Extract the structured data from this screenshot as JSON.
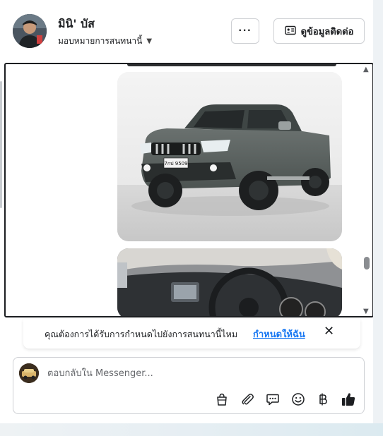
{
  "header": {
    "contact_name": "มินิ' บัส",
    "assign_label": "มอบหมายการสนทนานี้",
    "more_label": "···",
    "contact_info_label": "ดูข้อมูลติดต่อ"
  },
  "thread": {
    "images": [
      {
        "subject": "truck-photo",
        "plate_text": "7กป 9509"
      },
      {
        "subject": "interior-photo"
      }
    ]
  },
  "suggestion": {
    "question": "คุณต้องการได้รับการกำหนดไปยังการสนทนานี้ไหม",
    "action_label": "กำหนดให้ฉัน",
    "close_icon": "close-icon"
  },
  "composer": {
    "placeholder": "ตอบกลับใน Messenger...",
    "tools": [
      "shopping-bag-icon",
      "paperclip-icon",
      "saved-reply-icon",
      "emoji-icon",
      "baht-icon",
      "like-icon"
    ]
  },
  "colors": {
    "link": "#1877f2",
    "border": "#ced0d4",
    "text": "#1c1e21"
  }
}
